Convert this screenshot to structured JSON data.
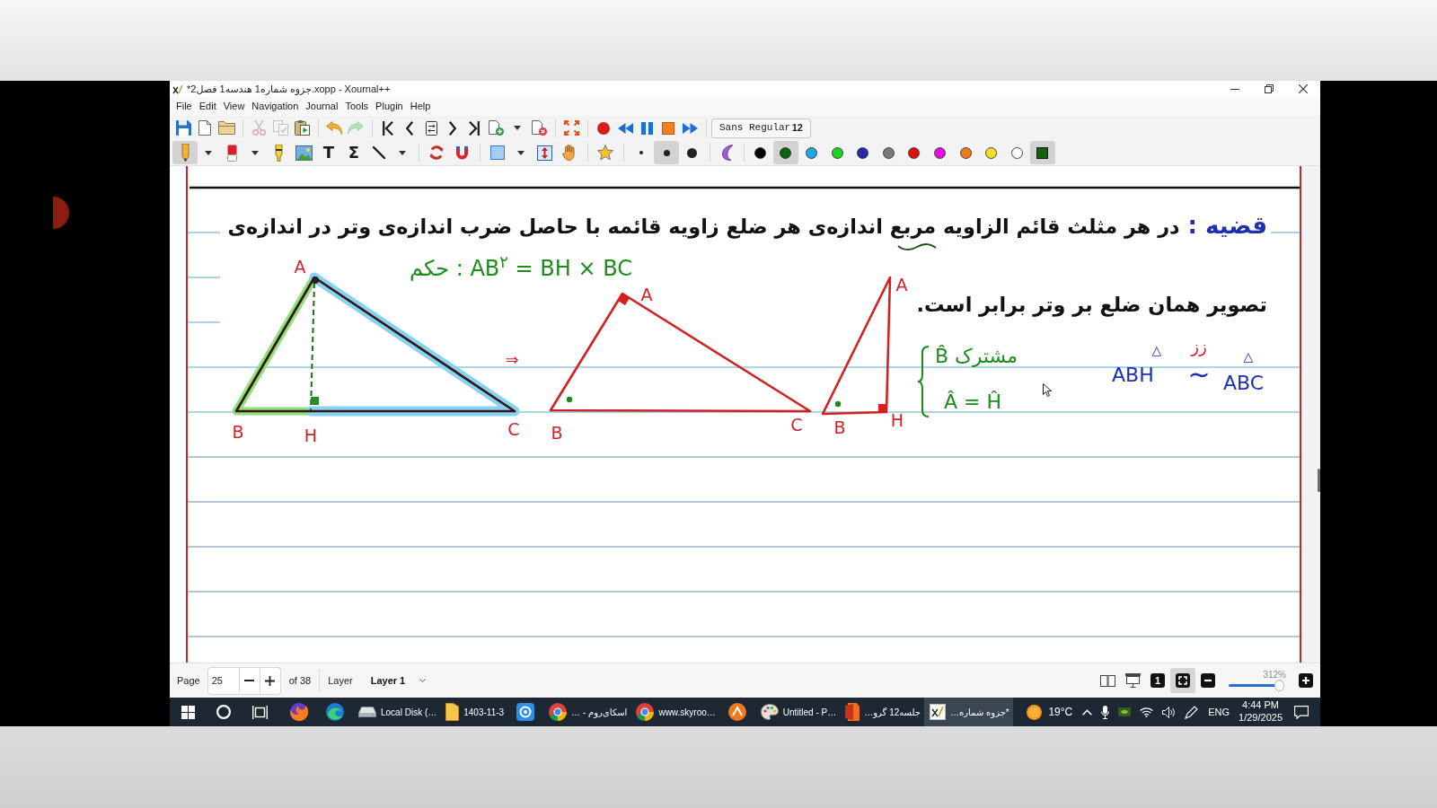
{
  "window": {
    "title": "*جزوه شماره1 هندسه1 فصل2.xopp - Xournal++"
  },
  "menu": [
    "File",
    "Edit",
    "View",
    "Navigation",
    "Journal",
    "Tools",
    "Plugin",
    "Help"
  ],
  "toolbar_1": {
    "buttons": [
      {
        "disabled": false
      },
      {
        "disabled": false
      },
      {
        "disabled": false
      },
      {
        "disabled": true
      },
      {
        "disabled": true
      },
      {
        "disabled": false
      },
      {
        "disabled": false
      },
      {
        "disabled": true
      },
      {
        "disabled": false
      },
      {
        "disabled": false
      },
      {
        "disabled": false
      },
      {
        "disabled": false
      },
      {
        "disabled": false
      },
      {
        "disabled": false
      },
      {
        "disabled": false
      },
      {
        "disabled": false
      },
      {
        "disabled": false
      },
      {
        "disabled": false
      },
      {
        "disabled": false
      },
      {
        "disabled": false
      },
      {
        "disabled": false
      }
    ],
    "font": "Sans Regular",
    "font_size": "12"
  },
  "toolbar_2": {
    "tools": [
      {
        "selected": true
      },
      {
        "selected": false
      },
      {
        "selected": false
      },
      {
        "selected": false
      },
      {
        "glyph": "T",
        "selected": false
      },
      {
        "glyph": "Σ",
        "selected": false
      },
      {
        "selected": false
      },
      {
        "selected": false
      },
      {
        "selected": false
      },
      {
        "selected": false
      },
      {
        "selected": false
      },
      {
        "selected": false
      },
      {
        "selected": false
      },
      {
        "selected": false
      }
    ],
    "pen_sizes": [
      {
        "selected": false
      },
      {
        "selected": true
      },
      {
        "selected": false
      }
    ],
    "colors": [
      {
        "kind": "dot",
        "color": "#000000",
        "selected": false
      },
      {
        "kind": "dot",
        "color": "#0a640a",
        "selected": true
      },
      {
        "kind": "dot",
        "color": "#1da6e6",
        "selected": false
      },
      {
        "kind": "dot",
        "color": "#1ed21e",
        "selected": false
      },
      {
        "kind": "dot",
        "color": "#2828a8",
        "selected": false
      },
      {
        "kind": "dot",
        "color": "#7a7a7a",
        "selected": false
      },
      {
        "kind": "dot",
        "color": "#e01010",
        "selected": false
      },
      {
        "kind": "dot",
        "color": "#e010e0",
        "selected": false
      },
      {
        "kind": "dot",
        "color": "#f07820",
        "selected": false
      },
      {
        "kind": "dot",
        "color": "#f0e020",
        "selected": false
      },
      {
        "kind": "dot",
        "color": "#ffffff",
        "selected": false
      },
      {
        "kind": "square",
        "color": "#0a640a",
        "selected": true
      }
    ]
  },
  "page": {
    "theorem": {
      "label": "قضیه :",
      "lines": [
        "در هر مثلث قائم الزاویه مربع اندازه‌ی هر ضلع زاویه قائمه با حاصل ضرب اندازه‌ی وتر در اندازه‌ی",
        "تصویر همان ضلع بر وتر برابر است."
      ]
    },
    "conclusion": "حکم : AB$^{۲}$ = BH × BC",
    "figures": [
      {
        "labels": [
          "A",
          "B",
          "H",
          "C"
        ]
      },
      {
        "labels": [
          "A",
          "B",
          "C"
        ]
      },
      {
        "labels": [
          "A",
          "B",
          "H"
        ]
      }
    ],
    "arrow": "⇒",
    "reasoning": [
      "B̂ مشترک",
      "Â = Ĥ"
    ],
    "similarity": {
      "left": "ABH",
      "left_mark": "△",
      "relation": "~",
      "note": "زز",
      "right": "ABC",
      "right_mark": "△"
    }
  },
  "status_bar": {
    "page_label": "Page",
    "page": "25",
    "page_count": "of 38",
    "layer_label": "Layer",
    "layer": "Layer 1",
    "view_buttons": [
      {
        "selected": false
      },
      {
        "selected": false
      },
      {
        "glyph": "1",
        "selected": false
      },
      {
        "selected": true
      }
    ],
    "zoom": "312%",
    "zoom_slider": {
      "level": 0.83
    }
  },
  "taskbar": {
    "apps": [
      {
        "selected": false
      },
      {
        "selected": false
      },
      {
        "label": "Local Disk (…",
        "selected": false
      },
      {
        "label": "1403-11-3",
        "selected": false
      },
      {
        "selected": false
      },
      {
        "label": "اسکای‌روم - …",
        "selected": false
      },
      {
        "label": "www.skyroo…",
        "selected": false
      },
      {
        "selected": false
      },
      {
        "label": "Untitled - P…",
        "selected": false
      },
      {
        "label": "جلسه12 گرو…",
        "selected": false
      },
      {
        "label": "*جزوه شماره…",
        "selected": true
      }
    ],
    "weather": "19°C",
    "language": "ENG",
    "time": "4:44 PM",
    "date": "1/29/2025"
  }
}
